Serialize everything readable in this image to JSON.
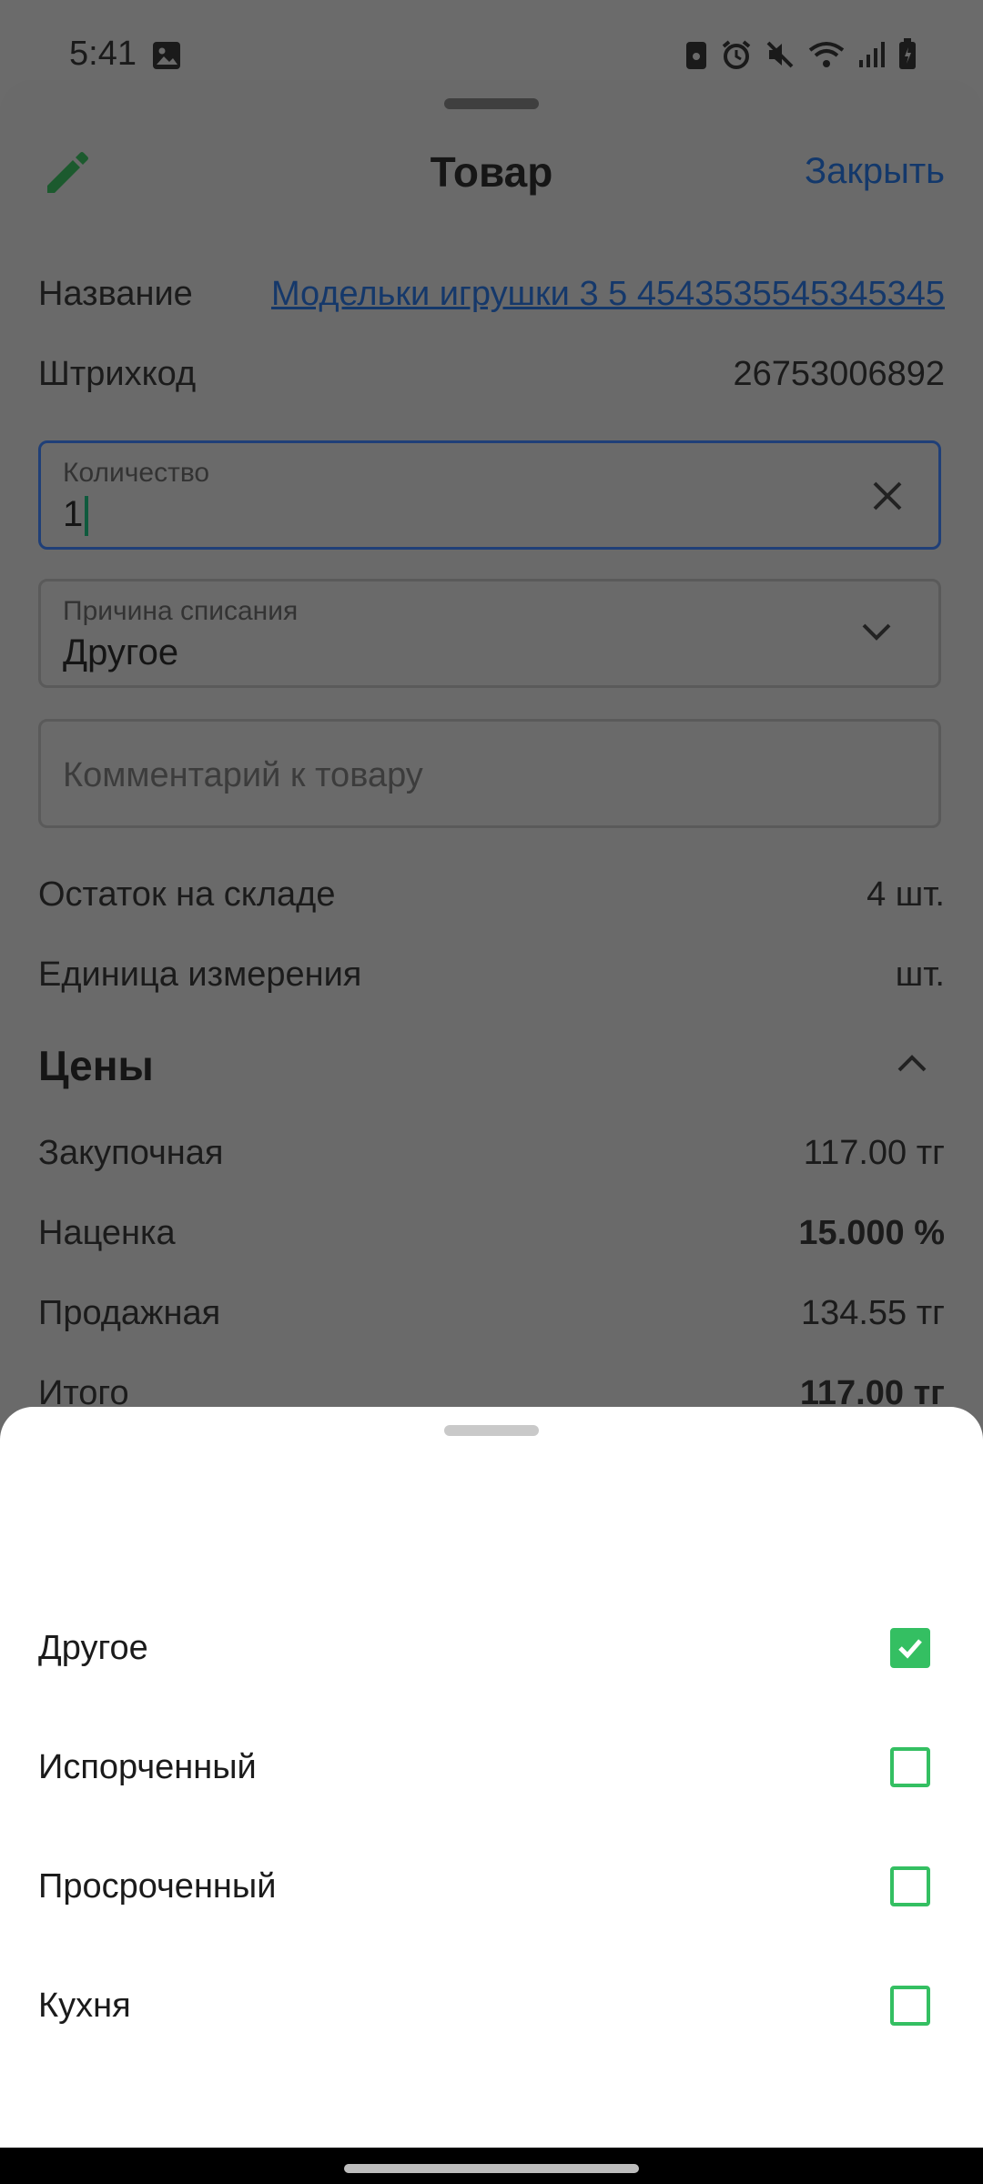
{
  "status_bar": {
    "time": "5:41"
  },
  "header": {
    "title": "Товар",
    "close_label": "Закрыть"
  },
  "details": {
    "name_label": "Название",
    "name_value": "Модельки игрушки 3 5 4543535545345345",
    "barcode_label": "Штрихкод",
    "barcode_value": "26753006892"
  },
  "quantity_field": {
    "label": "Количество",
    "value": "1"
  },
  "reason_field": {
    "label": "Причина списания",
    "value": "Другое"
  },
  "comment_field": {
    "placeholder": "Комментарий к товару"
  },
  "stock": {
    "label": "Остаток на складе",
    "value": "4 шт."
  },
  "unit": {
    "label": "Единица измерения",
    "value": "шт."
  },
  "prices": {
    "title": "Цены",
    "purchase_label": "Закупочная",
    "purchase_value": "117.00 тг",
    "markup_label": "Наценка",
    "markup_value": "15.000 %",
    "sale_label": "Продажная",
    "sale_value": "134.55 тг",
    "total_label": "Итого",
    "total_value": "117.00 тг"
  },
  "reason_options": [
    {
      "label": "Другое",
      "checked": true
    },
    {
      "label": "Испорченный",
      "checked": false
    },
    {
      "label": "Просроченный",
      "checked": false
    },
    {
      "label": "Кухня",
      "checked": false
    }
  ],
  "colors": {
    "accent_green": "#34bf62",
    "link_blue": "#1a5bb8"
  }
}
